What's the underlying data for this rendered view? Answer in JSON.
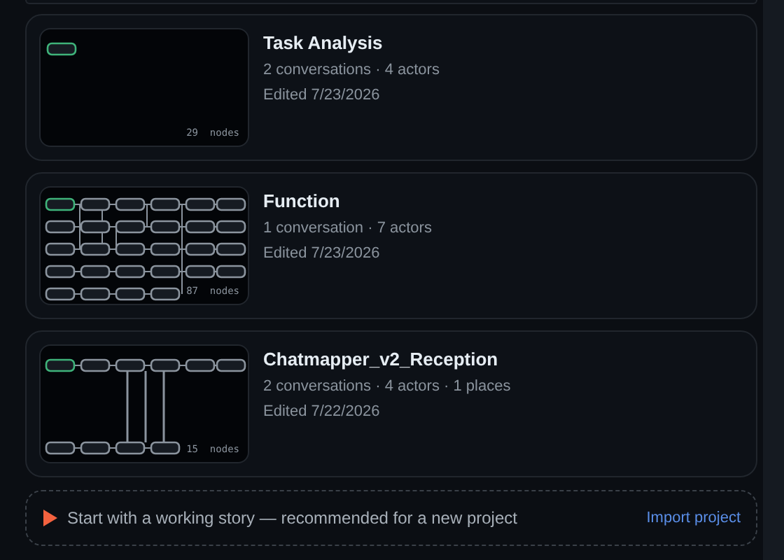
{
  "projects": [
    {
      "title": "Task Analysis",
      "meta": "2 conversations · 4 actors",
      "edited": "Edited 7/23/2026",
      "nodes": "29  nodes",
      "kind": "single"
    },
    {
      "title": "Function",
      "meta": "1 conversation · 7 actors",
      "edited": "Edited 7/23/2026",
      "nodes": "87  nodes",
      "kind": "grid"
    },
    {
      "title": "Chatmapper_v2_Reception",
      "meta": "2 conversations · 4 actors · 1 places",
      "edited": "Edited 7/22/2026",
      "nodes": "15  nodes",
      "kind": "rows"
    }
  ],
  "footer": {
    "text": "Start with a working story — recommended for a new project",
    "link": "Import project"
  }
}
